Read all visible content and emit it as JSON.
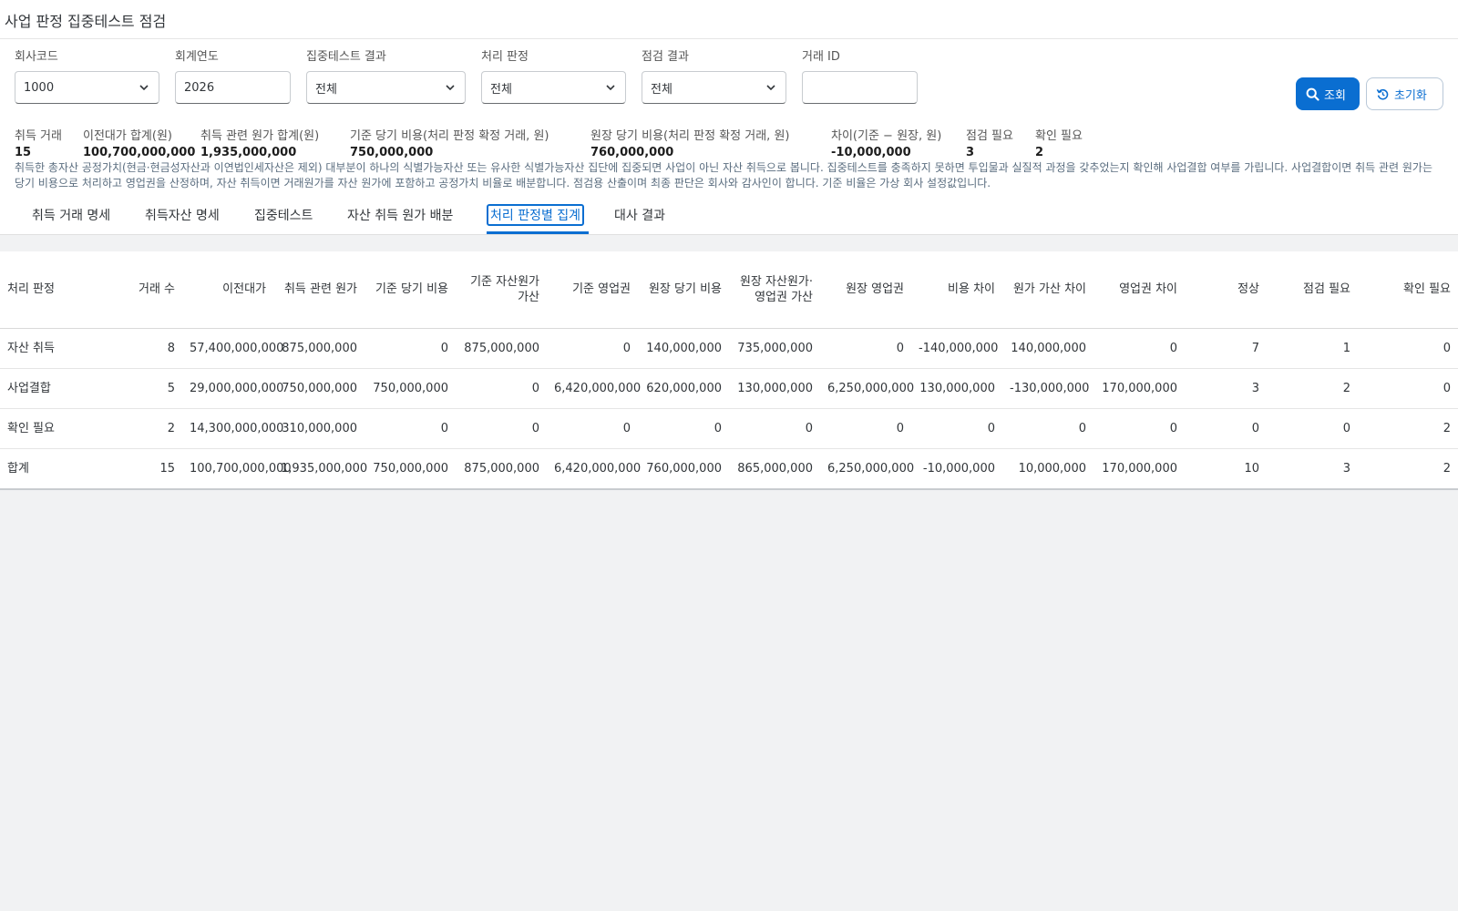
{
  "app": {
    "title": "사업 판정 집중테스트 점검"
  },
  "filters": {
    "company_code": {
      "label": "회사코드",
      "value": "1000"
    },
    "fiscal_year": {
      "label": "회계연도",
      "value": "2026"
    },
    "test_result": {
      "label": "집중테스트 결과",
      "value": "전체"
    },
    "treatment": {
      "label": "처리 판정",
      "value": "전체"
    },
    "check_result": {
      "label": "점검 결과",
      "value": "전체"
    },
    "deal_id": {
      "label": "거래 ID",
      "value": ""
    },
    "search_label": "조회",
    "reset_label": "초기화"
  },
  "summary": [
    {
      "label": "취득 거래",
      "value": "15"
    },
    {
      "label": "이전대가 합계(원)",
      "value": "100,700,000,000"
    },
    {
      "label": "취득 관련 원가 합계(원)",
      "value": "1,935,000,000"
    },
    {
      "label": "기준 당기 비용(처리 판정 확정 거래, 원)",
      "value": "750,000,000"
    },
    {
      "label": "원장 당기 비용(처리 판정 확정 거래, 원)",
      "value": "760,000,000"
    },
    {
      "label": "차이(기준 − 원장, 원)",
      "value": "-10,000,000"
    },
    {
      "label": "점검 필요",
      "value": "3"
    },
    {
      "label": "확인 필요",
      "value": "2"
    }
  ],
  "note": "취득한 총자산 공정가치(현금·현금성자산과 이연법인세자산은 제외) 대부분이 하나의 식별가능자산 또는 유사한 식별가능자산 집단에 집중되면 사업이 아닌 자산 취득으로 봅니다. 집중테스트를 충족하지 못하면 투입물과 실질적 과정을 갖추었는지 확인해 사업결합 여부를 가립니다. 사업결합이면 취득 관련 원가는 당기 비용으로 처리하고 영업권을 산정하며, 자산 취득이면 거래원가를 자산 원가에 포함하고 공정가치 비율로 배분합니다. 점검용 산출이며 최종 판단은 회사와 감사인이 합니다. 기준 비율은 가상 회사 설정값입니다.",
  "tabs": [
    {
      "label": "취득 거래 명세"
    },
    {
      "label": "취득자산 명세"
    },
    {
      "label": "집중테스트"
    },
    {
      "label": "자산 취득 원가 배분"
    },
    {
      "label": "처리 판정별 집계"
    },
    {
      "label": "대사 결과"
    }
  ],
  "active_tab": 4,
  "table": {
    "columns": [
      "처리 판정",
      "거래 수",
      "이전대가",
      "취득 관련 원가",
      "기준 당기 비용",
      "기준 자산원가 가산",
      "기준 영업권",
      "원장 당기 비용",
      "원장 자산원가·영업권 가산",
      "원장 영업권",
      "비용 차이",
      "원가 가산 차이",
      "영업권 차이",
      "정상",
      "점검 필요",
      "확인 필요"
    ],
    "rows": [
      [
        "자산 취득",
        "8",
        "57,400,000,000",
        "875,000,000",
        "0",
        "875,000,000",
        "0",
        "140,000,000",
        "735,000,000",
        "0",
        "-140,000,000",
        "140,000,000",
        "0",
        "7",
        "1",
        "0"
      ],
      [
        "사업결합",
        "5",
        "29,000,000,000",
        "750,000,000",
        "750,000,000",
        "0",
        "6,420,000,000",
        "620,000,000",
        "130,000,000",
        "6,250,000,000",
        "130,000,000",
        "-130,000,000",
        "170,000,000",
        "3",
        "2",
        "0"
      ],
      [
        "확인 필요",
        "2",
        "14,300,000,000",
        "310,000,000",
        "0",
        "0",
        "0",
        "0",
        "0",
        "0",
        "0",
        "0",
        "0",
        "0",
        "0",
        "2"
      ],
      [
        "합계",
        "15",
        "100,700,000,000",
        "1,935,000,000",
        "750,000,000",
        "875,000,000",
        "6,420,000,000",
        "760,000,000",
        "865,000,000",
        "6,250,000,000",
        "-10,000,000",
        "10,000,000",
        "170,000,000",
        "10",
        "3",
        "2"
      ]
    ]
  },
  "colors": {
    "accent": "#0a6ed1",
    "text": "#32363a",
    "note": "#5a6d7f",
    "background": "#f1f2f3"
  },
  "icons": {
    "select": "chevron-down-icon",
    "search": "search-icon",
    "reset": "reset-icon"
  }
}
